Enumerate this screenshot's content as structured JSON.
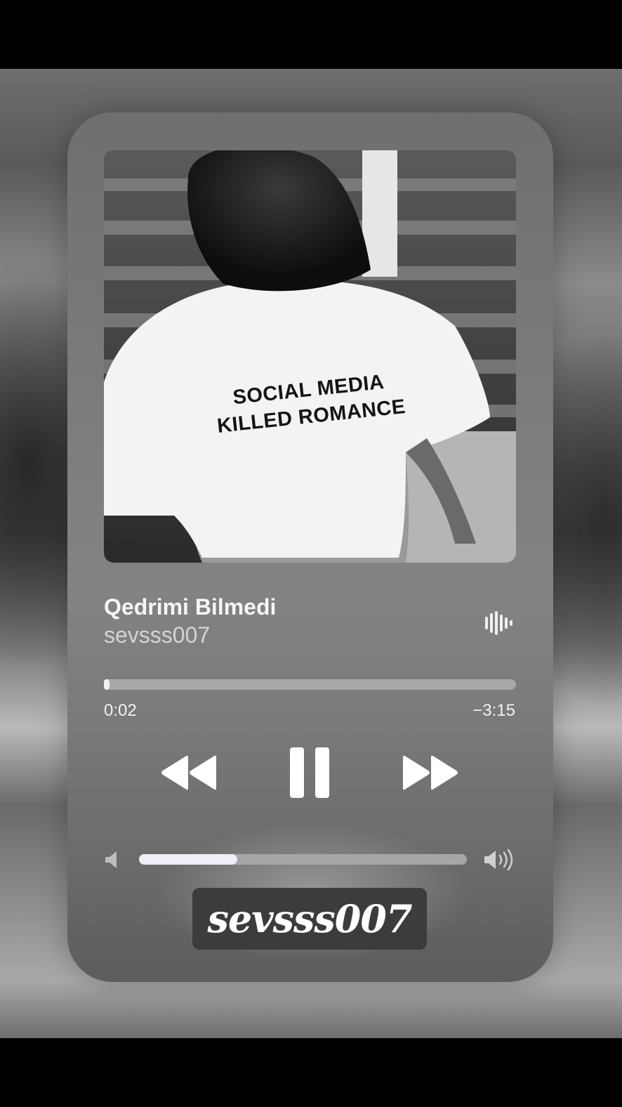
{
  "track": {
    "title": "Qedrimi Bilmedi",
    "artist": "sevsss007",
    "progress_fraction": 0.012,
    "elapsed": "0:02",
    "remaining": "−3:15"
  },
  "artwork": {
    "shirt_line1": "SOCIAL MEDIA",
    "shirt_line2": "KILLED ROMANCE"
  },
  "controls": {
    "rewind_icon": "rewind-icon",
    "pause_icon": "pause-icon",
    "forward_icon": "fast-forward-icon",
    "waveform_icon": "waveform-icon"
  },
  "volume": {
    "level_fraction": 0.3,
    "low_icon": "speaker-low-icon",
    "high_icon": "speaker-high-icon"
  },
  "watermark": {
    "text": "sevsss007"
  },
  "colors": {
    "text_primary": "#f5f5f5",
    "text_secondary": "#d4d4d4",
    "track_bg": "#a9a9a9",
    "track_fill": "#f2f2f2"
  }
}
